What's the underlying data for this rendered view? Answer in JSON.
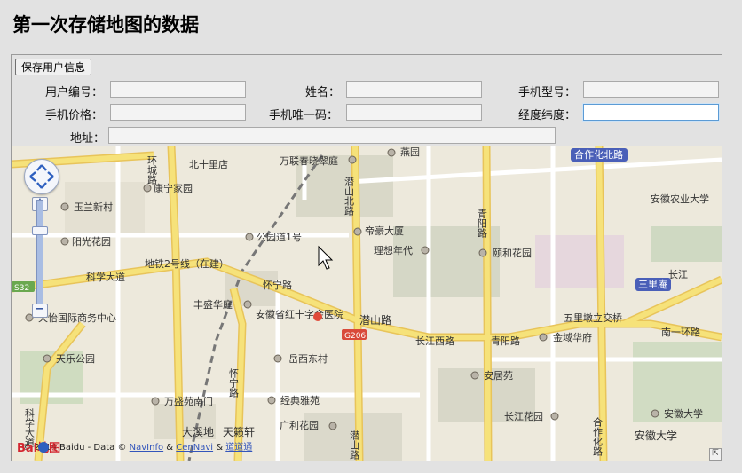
{
  "page": {
    "title": "第一次存储地图的数据"
  },
  "form": {
    "save_button": "保存用户信息",
    "fields": {
      "user_id": {
        "label": "用户编号：",
        "value": ""
      },
      "name": {
        "label": "姓名：",
        "value": ""
      },
      "phone_model": {
        "label": "手机型号：",
        "value": ""
      },
      "phone_price": {
        "label": "手机价格：",
        "value": ""
      },
      "phone_uid": {
        "label": "手机唯一码：",
        "value": ""
      },
      "lnglat": {
        "label": "经度纬度：",
        "value": ""
      },
      "address": {
        "label": "地址：",
        "value": ""
      }
    }
  },
  "map": {
    "places": {
      "beishidian": "北十里店",
      "kangningjiayuan": "康宁家园",
      "yulanxincun": "玉兰新村",
      "yangguanghuayuan": "阳光花园",
      "kexuedadao": "科学大道",
      "ditie2": "地铁2号线（在建）",
      "huainingroad": "怀宁路",
      "fengshenghuating": "丰盛华庭",
      "hongshizihospital": "安徽省红十字会医院",
      "tianlepark": "天乐公园",
      "internationalbiz": "天怡国际商务中心",
      "yuexidongcun": "岳西东村",
      "wanshengyuannanmen": "万盛苑南门",
      "jingdianyayuan": "经典雅苑",
      "guanglihuayuan": "广利花园",
      "daxidi": "大溪地",
      "tianlaixuan": "天籁轩",
      "wanlian": "万联春晓翠庭",
      "yanyuan": "燕园",
      "gongyuandao": "公园道1号",
      "dihaodasha": "帝豪大厦",
      "lixiangniandai": "理想年代",
      "yihehuayuan": "颐和花园",
      "qianshanroad_a": "潜山北路",
      "qianshanroad_b": "潜山路",
      "qianshanroad_c": "潜山路",
      "qingyangroad_a": "青阳路",
      "qingyangroad_b": "青阳路",
      "changjiangwest": "长江西路",
      "jinyuhuafu": "金域华府",
      "anjuyuan": "安居苑",
      "changjianghuayuan": "长江花园",
      "hezuohuabei": "合作化北路",
      "hezuohua": "合作化路",
      "anhuiagri": "安徽农业大学",
      "sanliyan": "三里庵",
      "wuliduiwenjiao": "五里墩立交桥",
      "nanyihuan": "南一环路",
      "changjiang2": "长江",
      "anhuiuniv": "安徽大学",
      "anhuiuniv2": "安徽大学",
      "huaining": "怀宁路",
      "huanroad": "环城路",
      "kexue": "科学大道",
      "g206": "G206",
      "s": "S32"
    },
    "copyright": {
      "logo_text": "Bai地图",
      "text": "© 2014 Baidu - Data ©",
      "navinfo": "NavInfo",
      "amp1": "&",
      "cennavi": "CenNavi",
      "amp2": "&",
      "daodaotong": "道道通"
    },
    "zoom_in": "+",
    "zoom_out": "−"
  },
  "colors": {
    "accent_road": "#f6e27a",
    "highway_label": "#4a5fb8",
    "map_bg": "#ede9dc"
  }
}
